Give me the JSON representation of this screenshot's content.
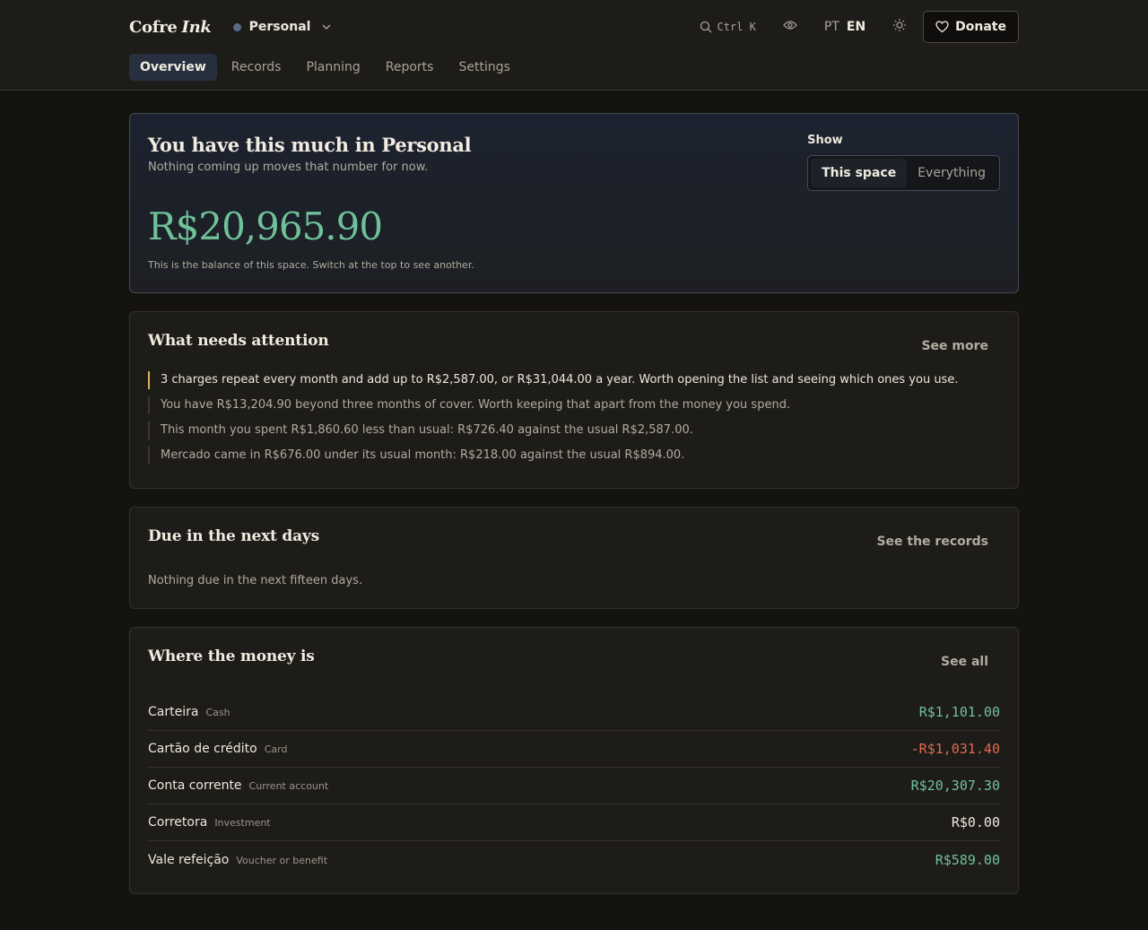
{
  "header": {
    "brand_main": "Cofre",
    "brand_accent": "Ink",
    "space": {
      "name": "Personal",
      "dot_color": "#5b6a8a"
    },
    "search_shortcut": "Ctrl K",
    "lang": {
      "pt": "PT",
      "en": "EN",
      "active": "EN"
    },
    "donate_label": "Donate"
  },
  "tabs": [
    {
      "label": "Overview",
      "active": true
    },
    {
      "label": "Records"
    },
    {
      "label": "Planning"
    },
    {
      "label": "Reports"
    },
    {
      "label": "Settings"
    }
  ],
  "hero": {
    "title": "You have this much in Personal",
    "subtitle": "Nothing coming up moves that number for now.",
    "amount": "R$20,965.90",
    "note": "This is the balance of this space. Switch at the top to see another.",
    "show_label": "Show",
    "toggle": {
      "this_space": "This space",
      "everything": "Everything",
      "active": "this_space"
    }
  },
  "attention": {
    "title": "What needs attention",
    "link": "See more",
    "items": [
      "3 charges repeat every month and add up to R$2,587.00, or R$31,044.00 a year. Worth opening the list and seeing which ones you use.",
      "You have R$13,204.90 beyond three months of cover. Worth keeping that apart from the money you spend.",
      "This month you spent R$1,860.60 less than usual: R$726.40 against the usual R$2,587.00.",
      "Mercado came in R$676.00 under its usual month: R$218.00 against the usual R$894.00."
    ]
  },
  "due": {
    "title": "Due in the next days",
    "link": "See the records",
    "empty": "Nothing due in the next fifteen days."
  },
  "money": {
    "title": "Where the money is",
    "link": "See all",
    "accounts": [
      {
        "name": "Carteira",
        "type": "Cash",
        "value": "R$1,101.00",
        "sign": "pos"
      },
      {
        "name": "Cartão de crédito",
        "type": "Card",
        "value": "-R$1,031.40",
        "sign": "neg"
      },
      {
        "name": "Conta corrente",
        "type": "Current account",
        "value": "R$20,307.30",
        "sign": "pos"
      },
      {
        "name": "Corretora",
        "type": "Investment",
        "value": "R$0.00",
        "sign": "zero"
      },
      {
        "name": "Vale refeição",
        "type": "Voucher or benefit",
        "value": "R$589.00",
        "sign": "pos"
      }
    ]
  },
  "colors": {
    "positive": "#6fc19a",
    "negative": "#e0684f",
    "accent": "#d9b358"
  }
}
